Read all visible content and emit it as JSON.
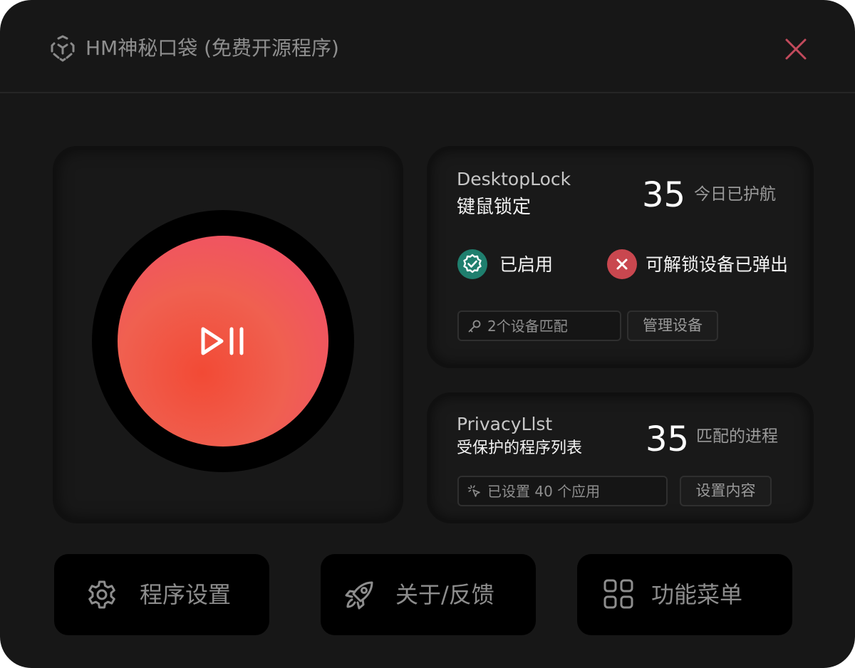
{
  "window": {
    "title": "HM神秘口袋 (免费开源程序)",
    "colors": {
      "background": "#171717",
      "accent_gradient": [
        "#f24a35",
        "#ef4a70"
      ],
      "close": "#c24a5c",
      "enabled_badge": "#1f7f6e",
      "error_badge": "#c9474f"
    }
  },
  "main_toggle": {
    "icon": "play-pause-icon"
  },
  "desktop_lock": {
    "title_en": "DesktopLock",
    "title_cn": "键鼠锁定",
    "count": "35",
    "count_label": "今日已护航",
    "status_enabled": "已启用",
    "status_device": "可解锁设备已弹出",
    "devices_chip": "2个设备匹配",
    "manage_button": "管理设备"
  },
  "privacy_list": {
    "title_en": "PrivacyLlst",
    "title_cn": "受保护的程序列表",
    "count": "35",
    "count_label": "匹配的进程",
    "apps_chip": "已设置 40 个应用",
    "settings_button": "设置内容"
  },
  "bottom_nav": {
    "settings_label": "程序设置",
    "about_label": "关于/反馈",
    "menu_label": "功能菜单"
  }
}
